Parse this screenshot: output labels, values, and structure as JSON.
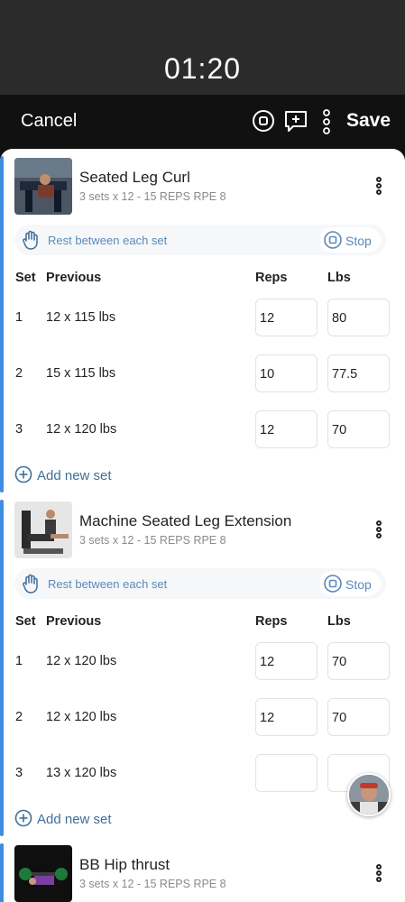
{
  "timer": "01:20",
  "toolbar": {
    "cancel_label": "Cancel",
    "save_label": "Save",
    "icons": [
      "stop-circle-icon",
      "add-comment-icon",
      "more-vertical-icon"
    ]
  },
  "table_headers": {
    "set": "Set",
    "previous": "Previous",
    "reps": "Reps",
    "lbs": "Lbs"
  },
  "exercises": [
    {
      "name": "Seated Leg Curl",
      "subtitle": "3 sets x 12 - 15  REPS RPE 8",
      "rest_label": "Rest between each set",
      "stop_label": "Stop",
      "sets": [
        {
          "num": "1",
          "previous": "12 x 115 lbs",
          "reps": "12",
          "lbs": "80"
        },
        {
          "num": "2",
          "previous": "15 x 115 lbs",
          "reps": "10",
          "lbs": "77.5"
        },
        {
          "num": "3",
          "previous": "12 x 120 lbs",
          "reps": "12",
          "lbs": "70"
        }
      ],
      "add_set_label": "Add new set"
    },
    {
      "name": "Machine Seated Leg Extension",
      "subtitle": "3 sets x 12 - 15  REPS RPE 8",
      "rest_label": "Rest between each set",
      "stop_label": "Stop",
      "sets": [
        {
          "num": "1",
          "previous": "12 x 120 lbs",
          "reps": "12",
          "lbs": "70"
        },
        {
          "num": "2",
          "previous": "12 x 120 lbs",
          "reps": "12",
          "lbs": "70"
        },
        {
          "num": "3",
          "previous": "13 x 120 lbs",
          "reps": "",
          "lbs": ""
        }
      ],
      "add_set_label": "Add new set"
    },
    {
      "name": "BB Hip thrust",
      "subtitle": "3 sets x 12 - 15  REPS RPE 8"
    }
  ],
  "colors": {
    "accent_blue": "#3c8de0",
    "link_blue": "#5b89b8",
    "header_dark": "#111111",
    "timer_bg": "#2b2b2b"
  }
}
